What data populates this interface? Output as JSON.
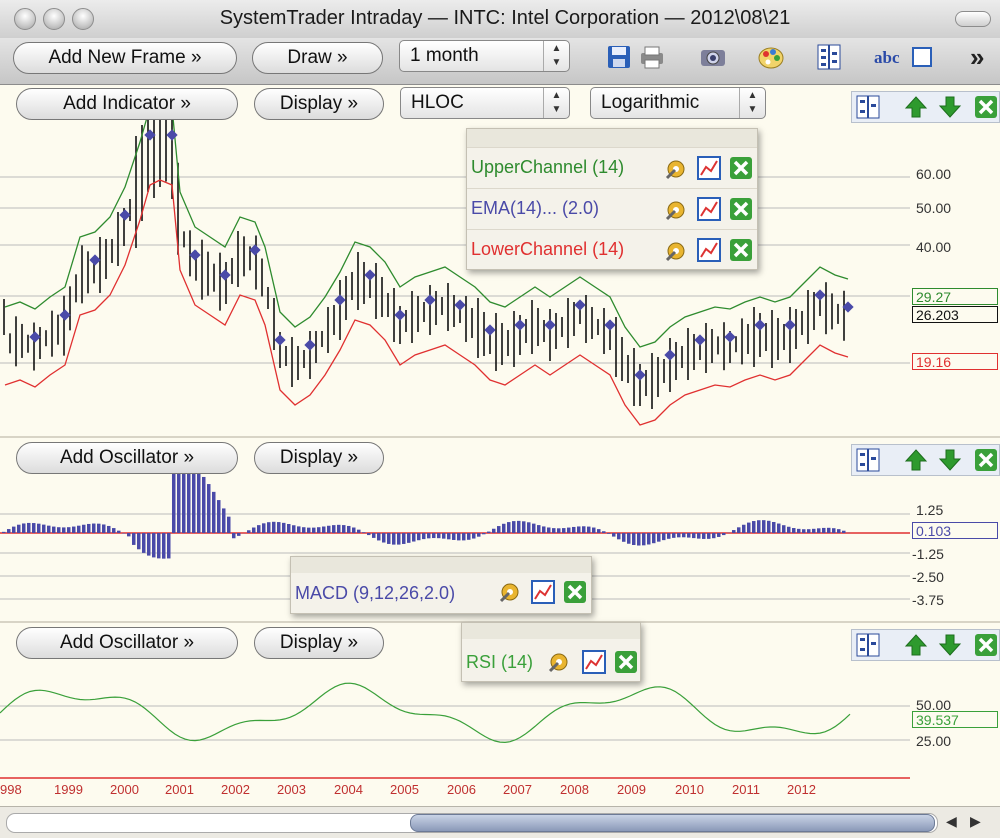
{
  "window": {
    "title": "SystemTrader Intraday — INTC: Intel Corporation — 2012\\08\\21"
  },
  "toolbar": {
    "add_frame": "Add New Frame »",
    "draw": "Draw »",
    "period": "1 month",
    "more": "»",
    "icons": [
      "save-icon",
      "print-icon",
      "camera-icon",
      "palette-icon",
      "layout-icon",
      "text-icon",
      "box-icon"
    ],
    "text_icon_label": "abc"
  },
  "price_pane": {
    "add_indicator": "Add Indicator »",
    "display": "Display »",
    "chart_type": "HLOC",
    "scale": "Logarithmic",
    "indicators": [
      {
        "label": "UpperChannel (14)",
        "color": "#2e8b2e"
      },
      {
        "label": "EMA(14)... (2.0)",
        "color": "#4a4aa8"
      },
      {
        "label": "LowerChannel (14)",
        "color": "#e03030"
      }
    ],
    "y_ticks": [
      "60.00",
      "50.00",
      "40.00"
    ],
    "last_upper": "29.27",
    "last_close": "26.203",
    "last_lower": "19.16"
  },
  "macd_pane": {
    "add_oscillator": "Add Oscillator »",
    "display": "Display »",
    "indicator": "MACD (9,12,26,2.0)",
    "indicator_color": "#4a4aa8",
    "y_ticks": [
      "1.25",
      "-1.25",
      "-2.50",
      "-3.75"
    ],
    "last_value": "0.103"
  },
  "rsi_pane": {
    "add_oscillator": "Add Oscillator »",
    "display": "Display »",
    "indicator": "RSI (14)",
    "indicator_color": "#3aa03a",
    "y_ticks": [
      "50.00",
      "25.00"
    ],
    "last_value": "39.537"
  },
  "x_axis": {
    "years": [
      "998",
      "1999",
      "2000",
      "2001",
      "2002",
      "2003",
      "2004",
      "2005",
      "2006",
      "2007",
      "2008",
      "2009",
      "2010",
      "2011",
      "2012"
    ]
  },
  "colors": {
    "upper": "#2e8b2e",
    "lower": "#e03030",
    "ema": "#4a4aa8",
    "bars": "#111111",
    "background": "#fdfbef"
  }
}
